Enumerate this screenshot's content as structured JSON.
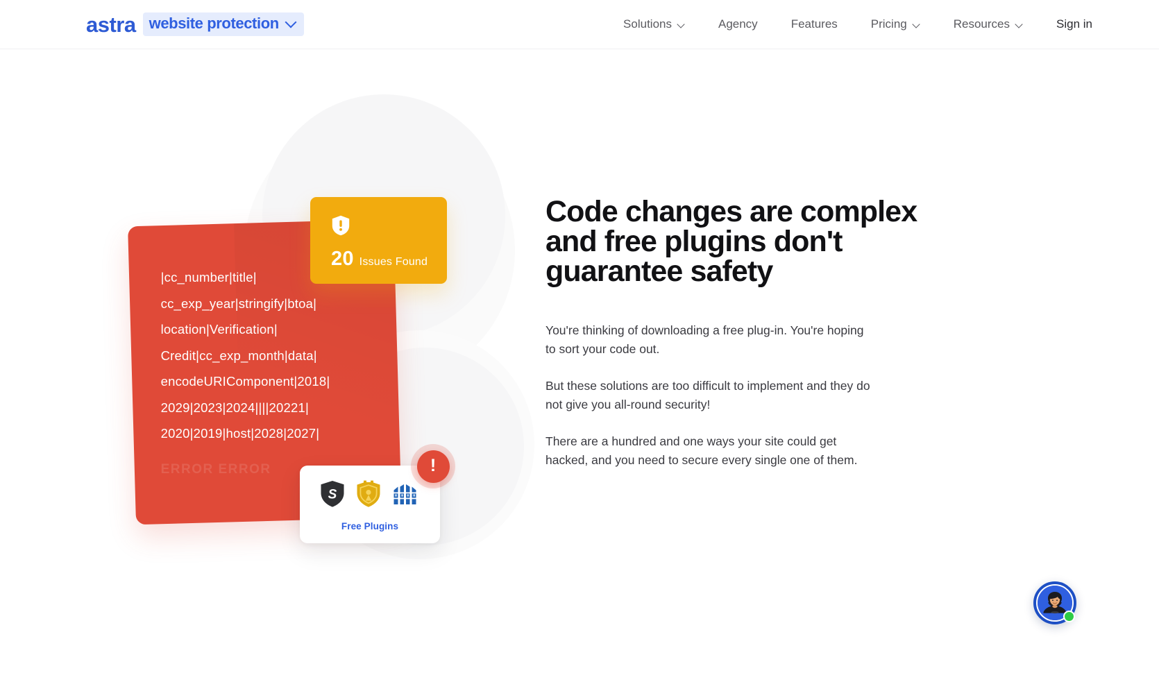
{
  "header": {
    "brand": {
      "astra": "astra",
      "pill": "website protection"
    },
    "nav": [
      {
        "label": "Solutions",
        "caret": true
      },
      {
        "label": "Agency",
        "caret": false
      },
      {
        "label": "Features",
        "caret": false
      },
      {
        "label": "Pricing",
        "caret": true
      },
      {
        "label": "Resources",
        "caret": true
      },
      {
        "label": "Sign in",
        "caret": false
      }
    ]
  },
  "hero": {
    "code_card": {
      "lines": [
        "|cc_number|title|",
        "cc_exp_year|stringify|btoa|",
        "location|Verification|",
        "Credit|cc_exp_month|data|",
        "encodeURIComponent|2018|",
        "2029|2023|2024||||20221|",
        "2020|2019|host|2028|2027|"
      ],
      "error_text": "ERROR  ERROR"
    },
    "issues_card": {
      "count": "20",
      "label": "Issues Found",
      "icon": "shield-alert-icon"
    },
    "plugins_card": {
      "label": "Free Plugins",
      "icons": [
        "sucuri-shield-icon",
        "wordfence-shield-icon",
        "ninja-firewall-icon"
      ]
    },
    "alert_badge": {
      "glyph": "!",
      "icon": "alert-exclamation-icon"
    }
  },
  "copy": {
    "heading_lines": [
      "Code changes are complex",
      "and free plugins don't",
      "guarantee safety"
    ],
    "paragraphs": [
      "You're thinking of downloading a free plug-in. You're hoping to sort your code out.",
      "But these solutions are too difficult to implement and they do not give you all-round security!",
      "There are a hundred and one ways your site could get hacked, and you need to secure every single one of them."
    ]
  },
  "chat": {
    "icon": "support-avatar-icon",
    "status": "online"
  },
  "colors": {
    "brand_blue": "#2f5fe0",
    "pill_bg": "#e5ecfd",
    "red_card": "#e04a38",
    "orange_card": "#f2ab0e",
    "heading": "#111114",
    "body_text": "#3a3a40",
    "status_green": "#2ecc45"
  }
}
